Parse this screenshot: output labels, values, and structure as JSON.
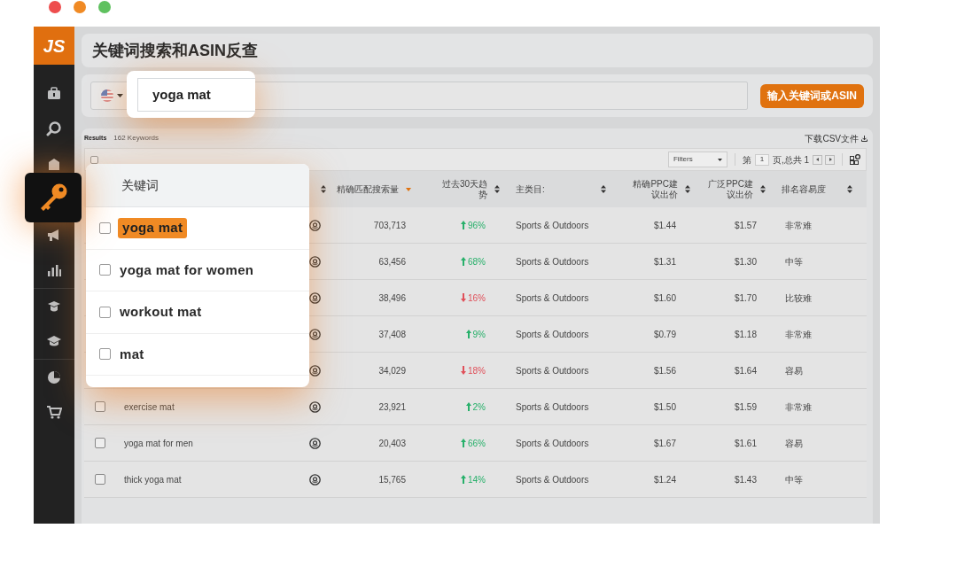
{
  "window": {
    "controls": [
      {
        "color": "#ee4d4d"
      },
      {
        "color": "#f08a24"
      },
      {
        "color": "#5fc15f"
      }
    ]
  },
  "app": {
    "logo": "JS",
    "title": "关键词搜索和ASIN反查"
  },
  "sidebar": {
    "items": [
      {
        "selected": false
      },
      {
        "selected": false
      },
      {
        "selected": false
      },
      {
        "selected": true
      },
      {
        "selected": false
      },
      {
        "selected": false
      },
      {
        "selected": false
      },
      {
        "selected": false
      },
      {
        "selected": false
      },
      {
        "selected": false
      }
    ]
  },
  "search": {
    "query": "yoga mat",
    "button": "输入关键词或ASIN"
  },
  "results": {
    "select_all_checked": false,
    "label": "Results",
    "count": "162 Keywords",
    "download": "下载CSV文件",
    "filter": "Filters",
    "page_prefix": "第",
    "page": "1",
    "page_suffix": "页,总共 1"
  },
  "table": {
    "columns": [
      {
        "sorted": false
      },
      {
        "label": "精确匹配搜索量",
        "sorted": true
      },
      {
        "label": "过去30天趋势",
        "sorted": false
      },
      {
        "label": "主类目:",
        "sorted": false
      },
      {
        "label": "精确PPC建议出价",
        "sorted": false
      },
      {
        "label": "广泛PPC建议出价",
        "sorted": false
      },
      {
        "label": "排名容易度",
        "sorted": false
      }
    ],
    "rows": [
      {
        "volume": "703,713",
        "trend": {
          "rising": true,
          "value": "96%"
        },
        "category": "Sports & Outdoors",
        "exact_ppc": "$1.44",
        "broad_ppc": "$1.57",
        "rank": "非常难"
      },
      {
        "volume": "63,456",
        "trend": {
          "rising": true,
          "value": "68%"
        },
        "category": "Sports & Outdoors",
        "exact_ppc": "$1.31",
        "broad_ppc": "$1.30",
        "rank": "中等"
      },
      {
        "volume": "38,496",
        "trend": {
          "rising": false,
          "value": "16%"
        },
        "category": "Sports & Outdoors",
        "exact_ppc": "$1.60",
        "broad_ppc": "$1.70",
        "rank": "比较难"
      },
      {
        "volume": "37,408",
        "trend": {
          "rising": true,
          "value": "9%"
        },
        "category": "Sports & Outdoors",
        "exact_ppc": "$0.79",
        "broad_ppc": "$1.18",
        "rank": "非常难"
      },
      {
        "volume": "34,029",
        "trend": {
          "rising": false,
          "value": "18%"
        },
        "category": "Sports & Outdoors",
        "exact_ppc": "$1.56",
        "broad_ppc": "$1.64",
        "rank": "容易"
      },
      {
        "keyword": "exercise mat",
        "checked": false,
        "volume": "23,921",
        "trend": {
          "rising": true,
          "value": "2%"
        },
        "category": "Sports & Outdoors",
        "exact_ppc": "$1.50",
        "broad_ppc": "$1.59",
        "rank": "非常难"
      },
      {
        "keyword": "yoga mat for men",
        "checked": false,
        "volume": "20,403",
        "trend": {
          "rising": true,
          "value": "66%"
        },
        "category": "Sports & Outdoors",
        "exact_ppc": "$1.67",
        "broad_ppc": "$1.61",
        "rank": "容易"
      },
      {
        "keyword": "thick yoga mat",
        "checked": false,
        "volume": "15,765",
        "trend": {
          "rising": true,
          "value": "14%"
        },
        "category": "Sports & Outdoors",
        "exact_ppc": "$1.24",
        "broad_ppc": "$1.43",
        "rank": "中等"
      }
    ]
  },
  "popup": {
    "header": "关键词",
    "items": [
      {
        "label": "yoga mat",
        "checked": false,
        "highlighted": true
      },
      {
        "label": "yoga mat for women",
        "checked": false,
        "highlighted": false
      },
      {
        "label": "workout mat",
        "checked": false,
        "highlighted": false
      },
      {
        "label": "mat",
        "checked": false,
        "highlighted": false
      }
    ]
  }
}
